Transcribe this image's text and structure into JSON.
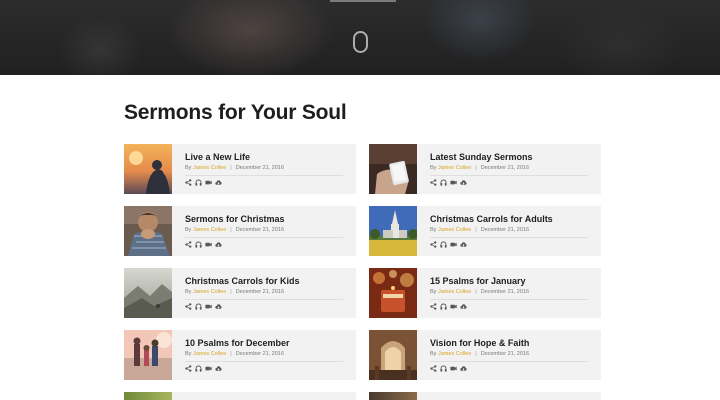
{
  "hero": {
    "scroll_hint_icon": "mouse-icon"
  },
  "section": {
    "title": "Sermons for Your Soul"
  },
  "colors": {
    "accent": "#d9a521",
    "card_bg": "#f2f2f2",
    "hero_bg": "#222222"
  },
  "cards": [
    {
      "title": "Live a New Life",
      "by": "By",
      "author": "James Collee",
      "date": "December 21, 2016",
      "thumb": "sunset-person"
    },
    {
      "title": "Latest Sunday Sermons",
      "by": "By",
      "author": "James Collee",
      "date": "December 21, 2016",
      "thumb": "phone-hands"
    },
    {
      "title": "Sermons for Christmas",
      "by": "By",
      "author": "James Collee",
      "date": "December 21, 2016",
      "thumb": "praying-man"
    },
    {
      "title": "Christmas Carrols for Adults",
      "by": "By",
      "author": "James Collee",
      "date": "December 21, 2016",
      "thumb": "church-field"
    },
    {
      "title": "Christmas Carrols for Kids",
      "by": "By",
      "author": "James Collee",
      "date": "December 21, 2016",
      "thumb": "mountain-mist"
    },
    {
      "title": "15 Psalms for January",
      "by": "By",
      "author": "James Collee",
      "date": "December 21, 2016",
      "thumb": "candles-bokeh"
    },
    {
      "title": "10 Psalms for December",
      "by": "By",
      "author": "James Collee",
      "date": "December 21, 2016",
      "thumb": "family-beach"
    },
    {
      "title": "Vision for Hope & Faith",
      "by": "By",
      "author": "James Collee",
      "date": "December 21, 2016",
      "thumb": "church-interior"
    }
  ],
  "card_icons": [
    "share-icon",
    "headphones-icon",
    "video-icon",
    "download-icon"
  ]
}
